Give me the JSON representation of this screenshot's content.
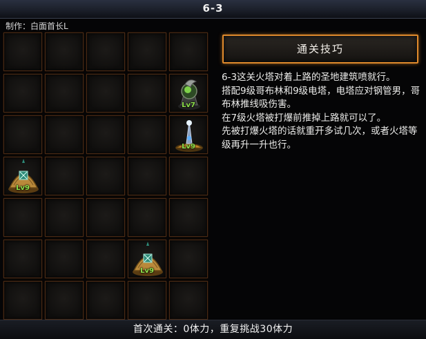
{
  "header": {
    "title": "6-3"
  },
  "credit": "制作：白面首长L",
  "tips_button_label": "通关技巧",
  "tips": [
    "6-3这关火塔对着上路的圣地建筑喷就行。",
    "搭配9级哥布林和9级电塔，电塔应对钢管男，哥布林推线吸伤害。",
    "在7级火塔被打爆前推掉上路就可以了。",
    "先被打爆火塔的话就重开多试几次，或者火塔等级再升一升也行。"
  ],
  "footer": "首次通关：0体力，重复挑战30体力",
  "grid": {
    "rows": 7,
    "cols": 5,
    "units": [
      {
        "row": 2,
        "col": 5,
        "type": "fire-tower",
        "level": "Lv7"
      },
      {
        "row": 3,
        "col": 5,
        "type": "electric-tower",
        "level": "Lv9"
      },
      {
        "row": 4,
        "col": 1,
        "type": "goblin-hut",
        "level": "Lv9"
      },
      {
        "row": 6,
        "col": 4,
        "type": "goblin-hut",
        "level": "Lv9"
      }
    ]
  },
  "colors": {
    "accent": "#e08a2c",
    "level": "#8ee04a",
    "cell_border": "#4a2a14"
  }
}
